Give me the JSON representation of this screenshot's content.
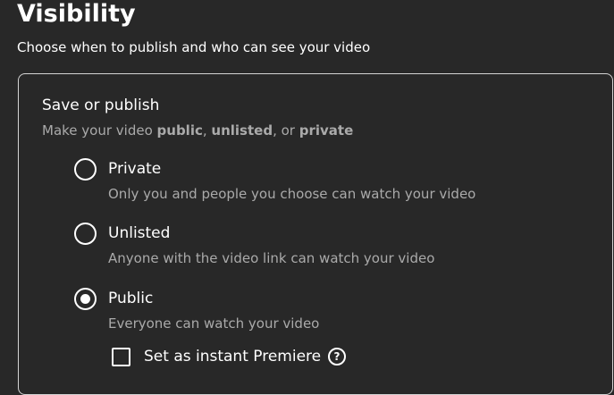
{
  "header": {
    "title": "Visibility",
    "subtitle": "Choose when to publish and who can see your video"
  },
  "save_publish": {
    "title": "Save or publish",
    "desc_prefix": "Make your video ",
    "desc_public": "public",
    "desc_sep1": ", ",
    "desc_unlisted": "unlisted",
    "desc_sep2": ", or ",
    "desc_private": "private",
    "options": [
      {
        "label": "Private",
        "description": "Only you and people you choose can watch your video",
        "selected": false
      },
      {
        "label": "Unlisted",
        "description": "Anyone with the video link can watch your video",
        "selected": false
      },
      {
        "label": "Public",
        "description": "Everyone can watch your video",
        "selected": true
      }
    ],
    "premiere": {
      "label": "Set as instant Premiere",
      "checked": false,
      "help_icon": "question-circle-icon",
      "help_glyph": "?"
    }
  },
  "colors": {
    "background": "#282828",
    "text_primary": "#ffffff",
    "text_secondary": "#aaaaaa",
    "border": "#d4d4d4"
  }
}
